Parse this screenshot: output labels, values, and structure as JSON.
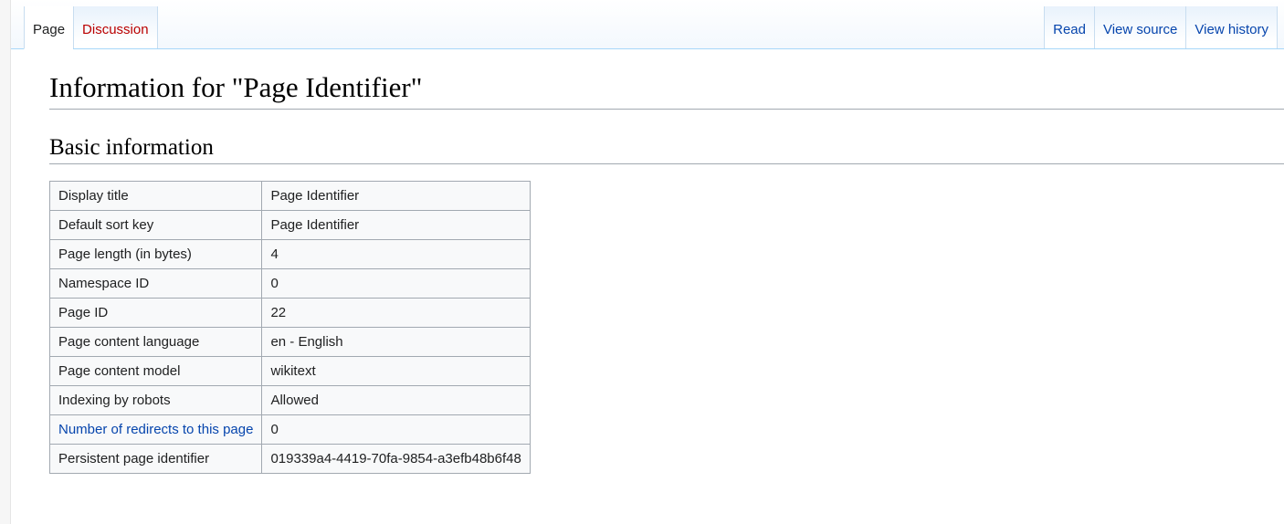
{
  "tabs": {
    "left": [
      {
        "label": "Page",
        "active": true,
        "redlink": false
      },
      {
        "label": "Discussion",
        "active": false,
        "redlink": true
      }
    ],
    "right": [
      {
        "label": "Read",
        "active": false
      },
      {
        "label": "View source",
        "active": false
      },
      {
        "label": "View history",
        "active": false
      }
    ]
  },
  "title": "Information for \"Page Identifier\"",
  "section_heading": "Basic information",
  "rows": [
    {
      "label": "Display title",
      "value": "Page Identifier",
      "link": false
    },
    {
      "label": "Default sort key",
      "value": "Page Identifier",
      "link": false
    },
    {
      "label": "Page length (in bytes)",
      "value": "4",
      "link": false
    },
    {
      "label": "Namespace ID",
      "value": "0",
      "link": false
    },
    {
      "label": "Page ID",
      "value": "22",
      "link": false
    },
    {
      "label": "Page content language",
      "value": "en - English",
      "link": false
    },
    {
      "label": "Page content model",
      "value": "wikitext",
      "link": false
    },
    {
      "label": "Indexing by robots",
      "value": "Allowed",
      "link": false
    },
    {
      "label": "Number of redirects to this page",
      "value": "0",
      "link": true
    },
    {
      "label": "Persistent page identifier",
      "value": "019339a4-4419-70fa-9854-a3efb48b6f48",
      "link": false
    }
  ]
}
